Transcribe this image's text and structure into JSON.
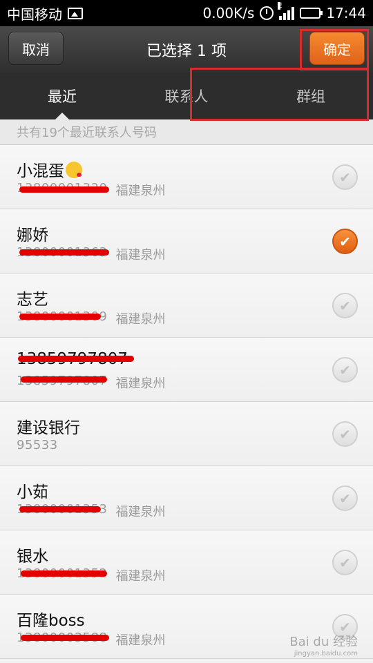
{
  "status_bar": {
    "carrier": "中国移动",
    "speed": "0.00K/s",
    "network_type": "E",
    "time": "17:44"
  },
  "header": {
    "cancel_label": "取消",
    "title": "已选择 1 项",
    "confirm_label": "确定"
  },
  "tabs": [
    {
      "label": "最近",
      "active": true
    },
    {
      "label": "联系人",
      "active": false
    },
    {
      "label": "群组",
      "active": false
    }
  ],
  "section_header": "共有19个最近联系人号码",
  "contacts": [
    {
      "name": "小混蛋",
      "phone": "13800001320",
      "location": "福建泉州",
      "checked": false
    },
    {
      "name": "娜娇",
      "phone": "13800001363",
      "location": "福建泉州",
      "checked": true
    },
    {
      "name": "志艺",
      "phone": "13800001309",
      "location": "福建泉州",
      "checked": false
    },
    {
      "name": "13859797807",
      "phone": "13859797807",
      "location": "福建泉州",
      "checked": false
    },
    {
      "name": "建设银行",
      "phone": "95533",
      "location": "",
      "checked": false
    },
    {
      "name": "小茹",
      "phone": "13800001353",
      "location": "福建泉州",
      "checked": false
    },
    {
      "name": "银水",
      "phone": "13800001352",
      "location": "福建泉州",
      "checked": false
    },
    {
      "name": "百隆boss",
      "phone": "13800003588",
      "location": "福建泉州",
      "checked": false
    }
  ],
  "watermark": {
    "brand": "Bai du 经验",
    "url": "jingyan.baidu.com"
  }
}
